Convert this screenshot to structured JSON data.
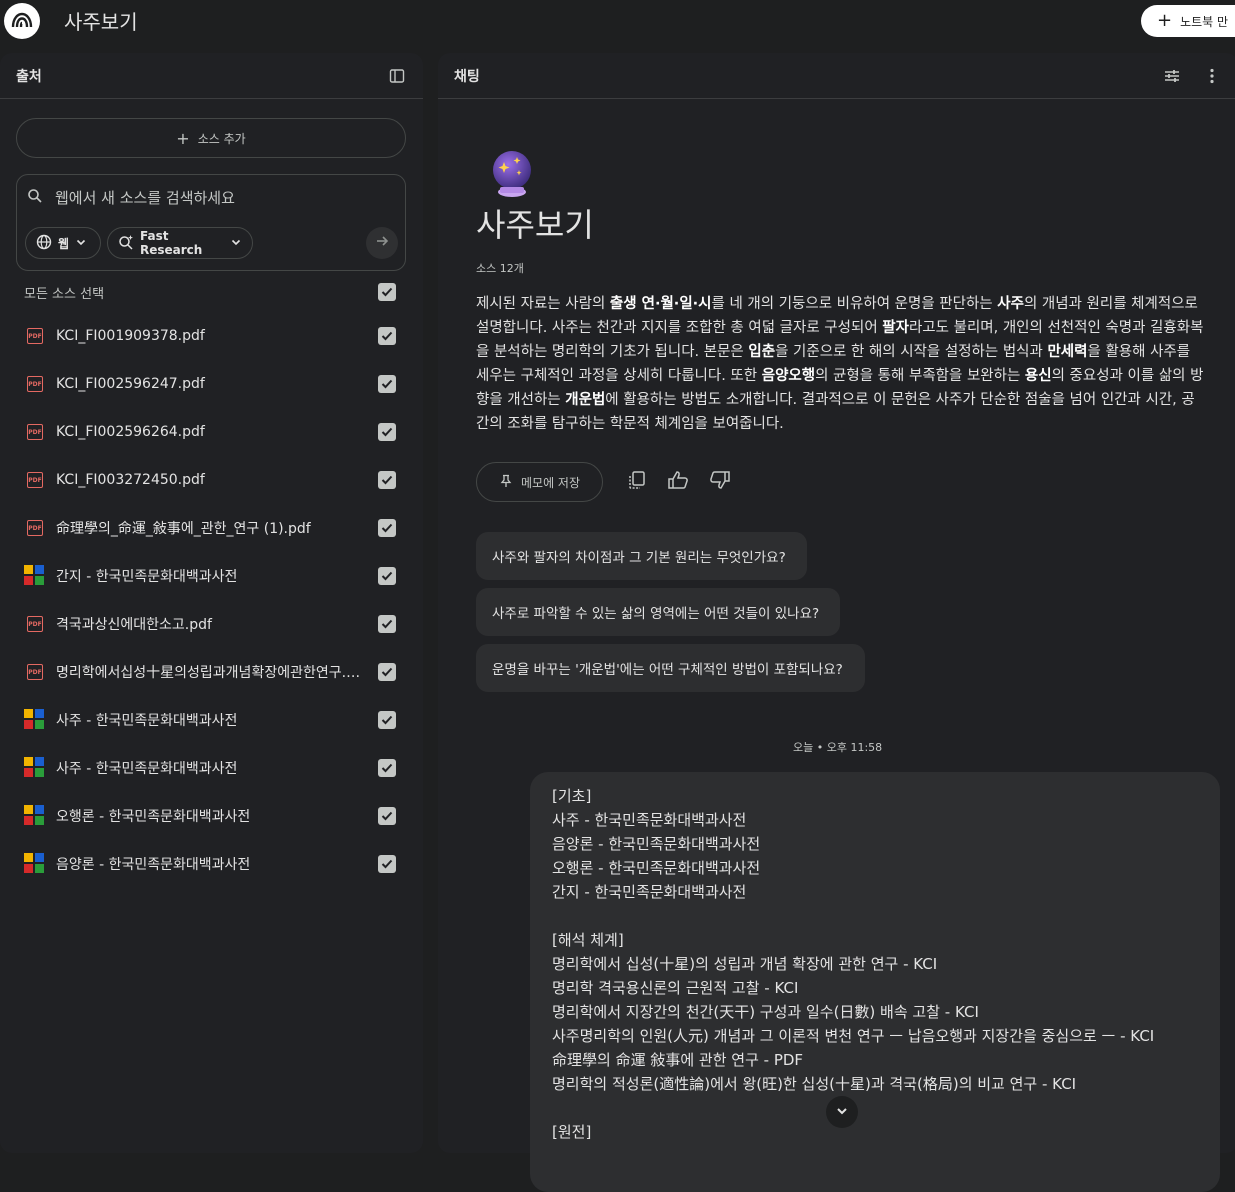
{
  "app": {
    "title": "사주보기",
    "new_notebook_label": "노트북 만",
    "logo_icon": "notebooklm-logo"
  },
  "sources_panel": {
    "title": "출처",
    "add_source_label": "소스 추가",
    "search_placeholder": "웹에서 새 소스를 검색하세요",
    "web_chip_label": "웹",
    "research_chip_label": "Fast Research",
    "select_all_label": "모든 소스 선택",
    "items": [
      {
        "name": "KCI_FI001909378.pdf",
        "type": "pdf",
        "checked": true
      },
      {
        "name": "KCI_FI002596247.pdf",
        "type": "pdf",
        "checked": true
      },
      {
        "name": "KCI_FI002596264.pdf",
        "type": "pdf",
        "checked": true
      },
      {
        "name": "KCI_FI003272450.pdf",
        "type": "pdf",
        "checked": true
      },
      {
        "name": "命理學의_命運_敍事에_관한_연구 (1).pdf",
        "type": "pdf",
        "checked": true
      },
      {
        "name": "간지 - 한국민족문화대백과사전",
        "type": "web",
        "checked": true
      },
      {
        "name": "격국과상신에대한소고.pdf",
        "type": "pdf",
        "checked": true
      },
      {
        "name": "명리학에서십성十星의성립과개념확장에관한연구.pdf",
        "type": "pdf",
        "checked": true
      },
      {
        "name": "사주 - 한국민족문화대백과사전",
        "type": "web",
        "checked": true
      },
      {
        "name": "사주 - 한국민족문화대백과사전",
        "type": "web",
        "checked": true
      },
      {
        "name": "오행론 - 한국민족문화대백과사전",
        "type": "web",
        "checked": true
      },
      {
        "name": "음양론 - 한국민족문화대백과사전",
        "type": "web",
        "checked": true
      }
    ]
  },
  "chat_panel": {
    "title": "채팅",
    "notebook_title": "사주보기",
    "source_count": "소스 12개",
    "summary_parts": [
      {
        "t": "제시된 자료는 사람의 ",
        "b": false
      },
      {
        "t": "출생 연·월·일·시",
        "b": true
      },
      {
        "t": "를 네 개의 기둥으로 비유하여 운명을 판단하는 ",
        "b": false
      },
      {
        "t": "사주",
        "b": true
      },
      {
        "t": "의 개념과 원리를 체계적으로 설명합니다. 사주는 천간과 지지를 조합한 총 여덟 글자로 구성되어 ",
        "b": false
      },
      {
        "t": "팔자",
        "b": true
      },
      {
        "t": "라고도 불리며, 개인의 선천적인 숙명과 길흉화복을 분석하는 명리학의 기초가 됩니다. 본문은 ",
        "b": false
      },
      {
        "t": "입춘",
        "b": true
      },
      {
        "t": "을 기준으로 한 해의 시작을 설정하는 법식과 ",
        "b": false
      },
      {
        "t": "만세력",
        "b": true
      },
      {
        "t": "을 활용해 사주를 세우는 구체적인 과정을 상세히 다룹니다. 또한 ",
        "b": false
      },
      {
        "t": "음양오행",
        "b": true
      },
      {
        "t": "의 균형을 통해 부족함을 보완하는 ",
        "b": false
      },
      {
        "t": "용신",
        "b": true
      },
      {
        "t": "의 중요성과 이를 삶의 방향을 개선하는 ",
        "b": false
      },
      {
        "t": "개운법",
        "b": true
      },
      {
        "t": "에 활용하는 방법도 소개합니다. 결과적으로 이 문헌은 사주가 단순한 점술을 넘어 인간과 시간, 공간의 조화를 탐구하는 학문적 체계임을 보여줍니다.",
        "b": false
      }
    ],
    "save_memo_label": "메모에 저장",
    "suggestions": [
      "사주와 팔자의 차이점과 그 기본 원리는 무엇인가요?",
      "사주로 파악할 수 있는 삶의 영역에는 어떤 것들이 있나요?",
      "운명을 바꾸는 '개운법'에는 어떤 구체적인 방법이 포함되나요?"
    ],
    "timestamp": "오늘 • 오후 11:58",
    "message_lines": [
      "[기초]",
      "사주 - 한국민족문화대백과사전",
      "음양론 - 한국민족문화대백과사전",
      "오행론 - 한국민족문화대백과사전",
      "간지 - 한국민족문화대백과사전",
      "",
      "[해석 체계]",
      "명리학에서 십성(十星)의 성립과 개념 확장에 관한 연구 - KCI",
      "명리학 격국용신론의 근원적 고찰 - KCI",
      "명리학에서 지장간의 천간(天干) 구성과 일수(日數) 배속 고찰 - KCI",
      "사주명리학의 인원(人元) 개념과 그 이론적 변천 연구 ㅡ 납음오행과 지장간을 중심으로 ㅡ - KCI",
      "命理學의 命運 敍事에 관한 연구 - PDF",
      "명리학의 적성론(適性論)에서 왕(旺)한 십성(十星)과 격국(格局)의 비교 연구 - KCI",
      "",
      "[원전]"
    ]
  },
  "colors": {
    "background": "#1e1f20",
    "panel": "#202124",
    "bubble": "#2d2e30",
    "pdf_red": "#e46962"
  }
}
